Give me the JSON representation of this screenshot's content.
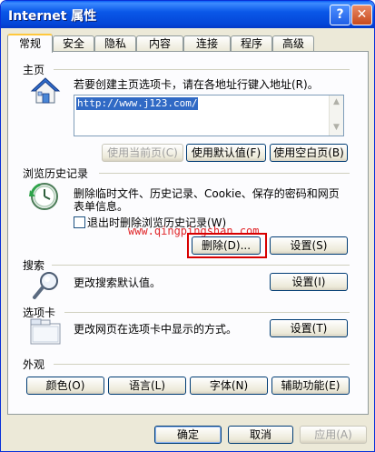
{
  "window": {
    "title": "Internet 属性",
    "help_glyph": "?",
    "close_glyph": "✕"
  },
  "tabs": [
    {
      "label": "常规"
    },
    {
      "label": "安全"
    },
    {
      "label": "隐私"
    },
    {
      "label": "内容"
    },
    {
      "label": "连接"
    },
    {
      "label": "程序"
    },
    {
      "label": "高级"
    }
  ],
  "home": {
    "section": "主页",
    "description": "若要创建主页选项卡，请在各地址行键入地址(R)。",
    "url": "http://www.j123.com/",
    "btn_current": "使用当前页(C)",
    "btn_default": "使用默认值(F)",
    "btn_blank": "使用空白页(B)"
  },
  "history": {
    "section": "浏览历史记录",
    "description_line1": "删除临时文件、历史记录、Cookie、保存的密码和网页",
    "description_line2": "表单信息。",
    "checkbox_label": "退出时删除浏览历史记录(W)",
    "btn_delete": "删除(D)...",
    "btn_settings": "设置(S)"
  },
  "watermark": "www.qingpingshan.com",
  "search": {
    "section": "搜索",
    "description": "更改搜索默认值。",
    "btn_settings": "设置(I)"
  },
  "tabsettings": {
    "section": "选项卡",
    "description": "更改网页在选项卡中显示的方式。",
    "btn_settings": "设置(T)"
  },
  "appearance": {
    "section": "外观",
    "btn_colors": "颜色(O)",
    "btn_languages": "语言(L)",
    "btn_fonts": "字体(N)",
    "btn_accessibility": "辅助功能(E)"
  },
  "footer": {
    "ok": "确定",
    "cancel": "取消",
    "apply": "应用(A)"
  }
}
